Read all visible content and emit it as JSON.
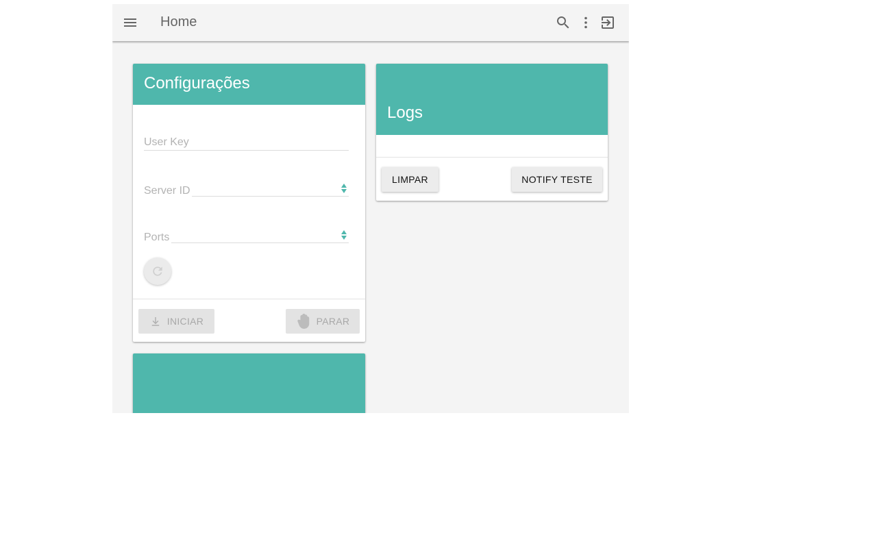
{
  "toolbar": {
    "title": "Home",
    "icons": [
      "menu-icon",
      "search-icon",
      "more-vert-icon",
      "exit-icon"
    ]
  },
  "config_card": {
    "title": "Configurações",
    "user_key": {
      "label": "User Key",
      "value": ""
    },
    "server_id": {
      "label": "Server ID",
      "value": ""
    },
    "ports": {
      "label": "Ports",
      "value": ""
    },
    "refresh_icon": "refresh-icon",
    "start_label": "INICIAR",
    "start_icon": "download-icon",
    "stop_label": "PARAR",
    "stop_icon": "hand-icon"
  },
  "logs_card": {
    "title": "Logs",
    "clear_label": "LIMPAR",
    "notify_label": "NOTIFY TESTE"
  },
  "colors": {
    "accent": "#4fb7ac",
    "background": "#f4f4f4",
    "card": "#ffffff"
  }
}
